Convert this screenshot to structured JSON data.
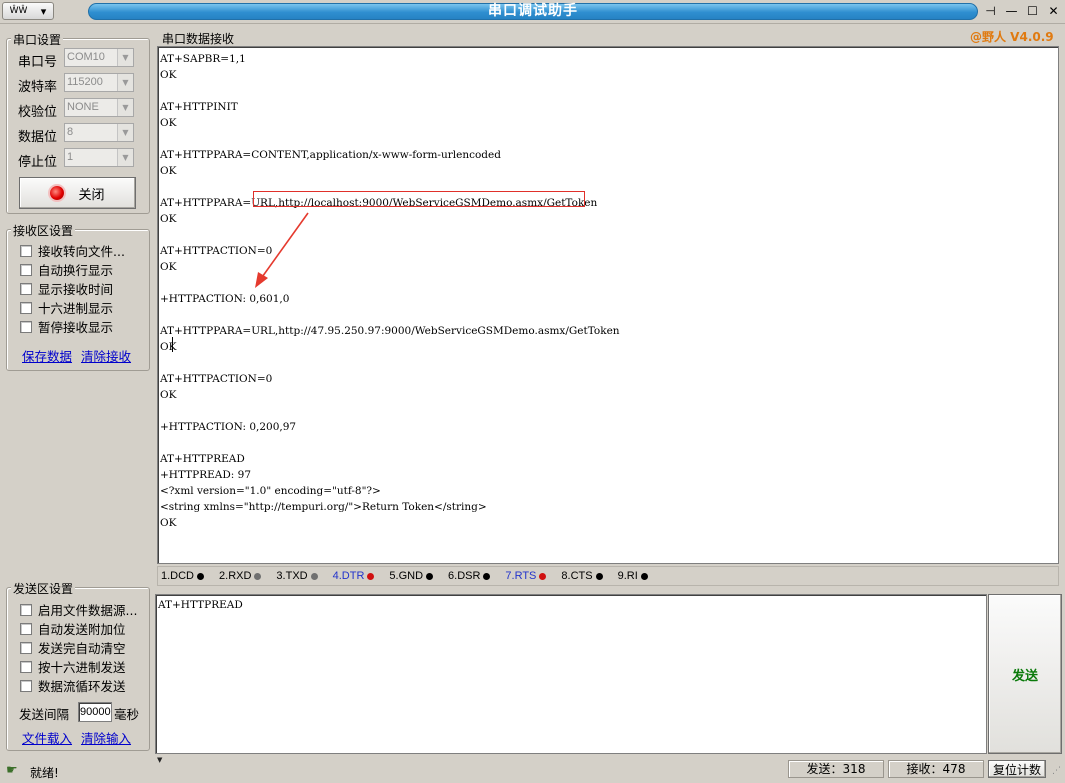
{
  "window": {
    "title": "串口调试助手",
    "sysmenu_glyph": "ŴŴ",
    "version": "@野人 V4.0.9"
  },
  "serial_settings": {
    "group_label": "串口设置",
    "port": {
      "label": "串口号",
      "value": "COM10"
    },
    "baud": {
      "label": "波特率",
      "value": "115200"
    },
    "parity": {
      "label": "校验位",
      "value": "NONE"
    },
    "databits": {
      "label": "数据位",
      "value": "8"
    },
    "stopbits": {
      "label": "停止位",
      "value": "1"
    },
    "close_button": "关闭"
  },
  "recv_settings": {
    "group_label": "接收区设置",
    "options": [
      "接收转向文件...",
      "自动换行显示",
      "显示接收时间",
      "十六进制显示",
      "暂停接收显示"
    ],
    "save_link": "保存数据",
    "clear_link": "清除接收"
  },
  "send_settings": {
    "group_label": "发送区设置",
    "options": [
      "启用文件数据源...",
      "自动发送附加位",
      "发送完自动清空",
      "按十六进制发送",
      "数据流循环发送"
    ],
    "interval_label": "发送间隔",
    "interval_value": "90000",
    "interval_unit": "毫秒",
    "load_link": "文件载入",
    "clear_link": "清除输入"
  },
  "receive": {
    "label": "串口数据接收",
    "lines": [
      "AT+SAPBR=1,1",
      "OK",
      "",
      "AT+HTTPINIT",
      "OK",
      "",
      "AT+HTTPPARA=CONTENT,application/x-www-form-urlencoded",
      "OK",
      "",
      "AT+HTTPPARA=URL,http://localhost:9000/WebServiceGSMDemo.asmx/GetToken",
      "OK",
      "",
      "AT+HTTPACTION=0",
      "OK",
      "",
      "+HTTPACTION: 0,601,0",
      "",
      "AT+HTTPPARA=URL,http://47.95.250.97:9000/WebServiceGSMDemo.asmx/GetToken",
      "OK",
      "",
      "AT+HTTPACTION=0",
      "OK",
      "",
      "+HTTPACTION: 0,200,97",
      "",
      "AT+HTTPREAD",
      "+HTTPREAD: 97",
      "<?xml version=\"1.0\" encoding=\"utf-8\"?>",
      "<string xmlns=\"http://tempuri.org/\">Return Token</string>",
      "OK"
    ]
  },
  "pins": [
    {
      "label": "1.DCD",
      "color": "#000000",
      "label_color": "#000000"
    },
    {
      "label": "2.RXD",
      "color": "#707070",
      "label_color": "#000000"
    },
    {
      "label": "3.TXD",
      "color": "#707070",
      "label_color": "#000000"
    },
    {
      "label": "4.DTR",
      "color": "#d01010",
      "label_color": "#2233cc"
    },
    {
      "label": "5.GND",
      "color": "#000000",
      "label_color": "#000000"
    },
    {
      "label": "6.DSR",
      "color": "#000000",
      "label_color": "#000000"
    },
    {
      "label": "7.RTS",
      "color": "#d01010",
      "label_color": "#2233cc"
    },
    {
      "label": "8.CTS",
      "color": "#000000",
      "label_color": "#000000"
    },
    {
      "label": "9.RI",
      "color": "#000000",
      "label_color": "#000000"
    }
  ],
  "send": {
    "input_text": "AT+HTTPREAD",
    "button": "发送"
  },
  "status": {
    "ready": "就绪!",
    "sent": "发送：318",
    "received": "接收：478",
    "reset_button": "复位计数"
  }
}
